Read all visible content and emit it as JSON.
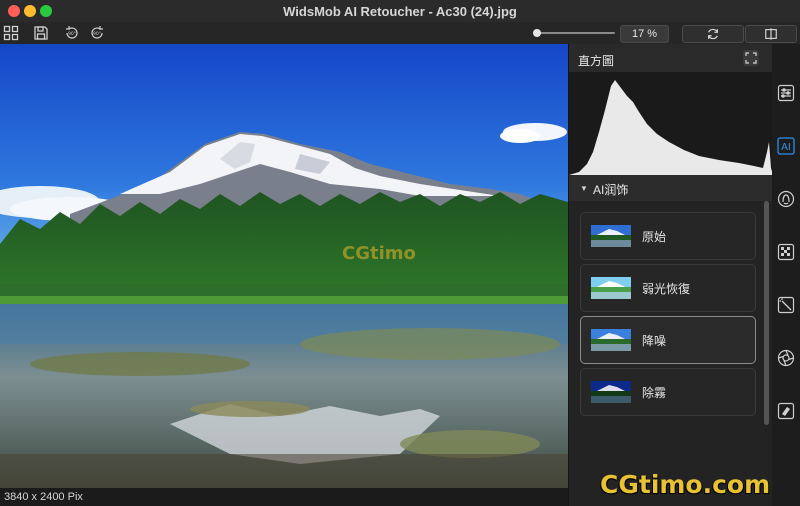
{
  "window": {
    "title": "WidsMob AI Retoucher - Ac30 (24).jpg"
  },
  "toolbar": {
    "zoom_value": "17 %",
    "zoom_level": 0.05
  },
  "canvas": {
    "watermark": "CGtimo"
  },
  "status": {
    "dimensions": "3840 x 2400 Pix"
  },
  "histogram": {
    "title": "直方圖"
  },
  "ai_panel": {
    "title": "AI润饰",
    "presets": [
      {
        "label": "原始",
        "selected": false
      },
      {
        "label": "弱光恢復",
        "selected": false
      },
      {
        "label": "降噪",
        "selected": true
      },
      {
        "label": "除霧",
        "selected": false
      }
    ]
  },
  "sidebar": {
    "icons": [
      "adjust-sliders-icon",
      "ai-icon",
      "portrait-icon",
      "mosaic-icon",
      "magic-wand-icon",
      "aperture-icon",
      "eraser-icon"
    ],
    "ai_label": "AI"
  },
  "watermark": {
    "site": "CGtimo.com"
  },
  "colors": {
    "accent": "#2f8ee8",
    "sky_top": "#1447c8",
    "sky_bottom": "#3c8ee0",
    "forest": "#1f5a22",
    "panel_bg": "#232323"
  }
}
